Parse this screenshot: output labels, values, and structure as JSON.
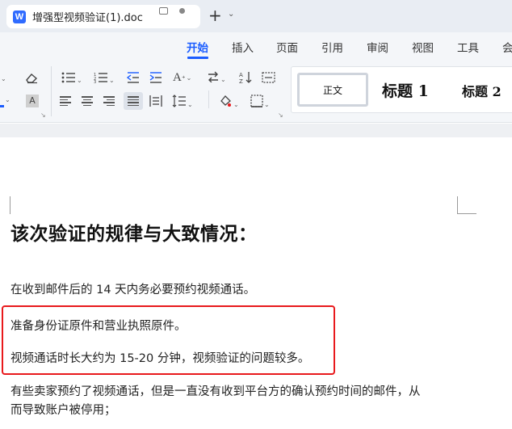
{
  "window": {
    "app_icon_letter": "W",
    "doc_title": "增强型视频验证(1).doc",
    "new_tab_symbol": "+",
    "tab_list_symbol": "⌄"
  },
  "menu": {
    "items": [
      "开始",
      "插入",
      "页面",
      "引用",
      "审阅",
      "视图",
      "工具",
      "会"
    ],
    "active": "开始",
    "accent_color": "#1a5cff"
  },
  "ribbon": {
    "font_color_letter": "A",
    "highlight_letter": "A",
    "styles": {
      "normal": "正文",
      "heading1": "标题 1",
      "heading2": "标题 2"
    }
  },
  "document": {
    "heading": "该次验证的规律与大致情况：",
    "paragraphs": [
      "在收到邮件后的 14 天内务必要预约视频通话。",
      "准备身份证原件和营业执照原件。",
      "视频通话时长大约为 15-20 分钟，视频验证的问题较多。",
      "有些卖家预约了视频通话，但是一直没有收到平台方的确认预约时间的邮件，从",
      "而导致账户被停用；"
    ],
    "annotation_color": "#e8191c"
  }
}
